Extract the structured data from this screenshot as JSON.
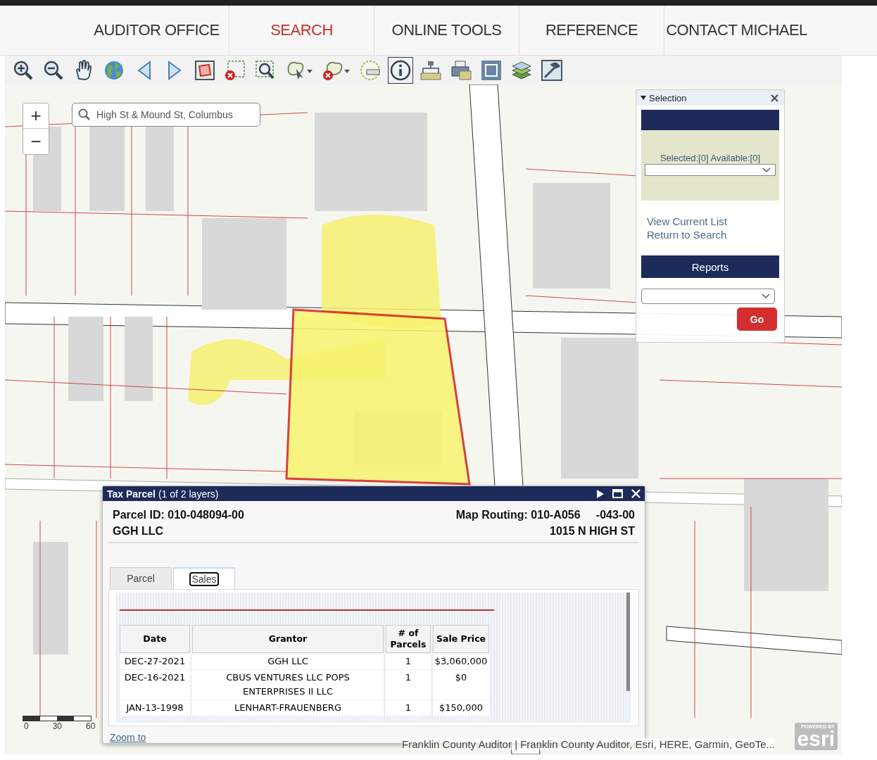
{
  "nav": [
    {
      "label": "AUDITOR OFFICE",
      "selected": false
    },
    {
      "label": "SEARCH",
      "selected": true
    },
    {
      "label": "ONLINE TOOLS",
      "selected": false
    },
    {
      "label": "REFERENCE",
      "selected": false
    },
    {
      "label": "CONTACT MICHAEL",
      "selected": false
    }
  ],
  "toolbar": [
    {
      "kind": "zoom-in",
      "selected": false
    },
    {
      "kind": "zoom-out",
      "selected": false
    },
    {
      "kind": "pan",
      "selected": false
    },
    {
      "kind": "globe",
      "selected": false
    },
    {
      "kind": "back",
      "selected": false
    },
    {
      "kind": "forward",
      "selected": false
    },
    {
      "kind": "extent",
      "selected": false
    },
    {
      "kind": "clear-box",
      "selected": false
    },
    {
      "kind": "zoom-box",
      "selected": false
    },
    {
      "kind": "lasso",
      "selected": false
    },
    {
      "kind": "lasso-clear",
      "selected": false
    },
    {
      "kind": "measure",
      "selected": false
    },
    {
      "kind": "info",
      "selected": true
    },
    {
      "kind": "network",
      "selected": false
    },
    {
      "kind": "print",
      "selected": false
    },
    {
      "kind": "fullscreen",
      "selected": false
    },
    {
      "kind": "layers",
      "selected": false
    },
    {
      "kind": "tools",
      "selected": false
    }
  ],
  "map": {
    "zoom_in": "+",
    "zoom_out": "−",
    "search": {
      "value": "High St & Mound St, Columbus"
    },
    "scale": [
      "0",
      "30",
      "60"
    ],
    "attribution": "Franklin County Auditor | Franklin County Auditor, Esri, HERE, Garmin, GeoTe...",
    "logo": {
      "top": "POWERED BY",
      "word": "esri"
    }
  },
  "selection_panel": {
    "title": "Selection",
    "counts": "Selected:[0] Available:[0]",
    "links": [
      "View Current List",
      "Return to Search"
    ],
    "reports": "Reports",
    "go": "Go"
  },
  "popup": {
    "title": "**Tax Parcel** (1 of 2 layers)",
    "parcel_id": "Parcel ID: 010-048094-00",
    "map_routing": "Map Routing: 010-A056     -043-00",
    "owner": "GGH LLC",
    "address": "1015 N HIGH ST",
    "tabs": [
      {
        "label": "Parcel",
        "selected": false
      },
      {
        "label": "Sales",
        "selected": true
      }
    ],
    "table": {
      "columns": [
        "Date",
        "Grantor",
        "# of Parcels",
        "Sale Price"
      ],
      "rows": [
        [
          "DEC-27-2021",
          "GGH LLC",
          "1",
          "$3,060,000"
        ],
        [
          "DEC-16-2021",
          "CBUS VENTURES LLC POPS ENTERPRISES II LLC",
          "1",
          "$0"
        ],
        [
          "JAN-13-1998",
          "LENHART-FRAUENBERG",
          "1",
          "$150,000"
        ]
      ]
    },
    "link": "Zoom to"
  }
}
